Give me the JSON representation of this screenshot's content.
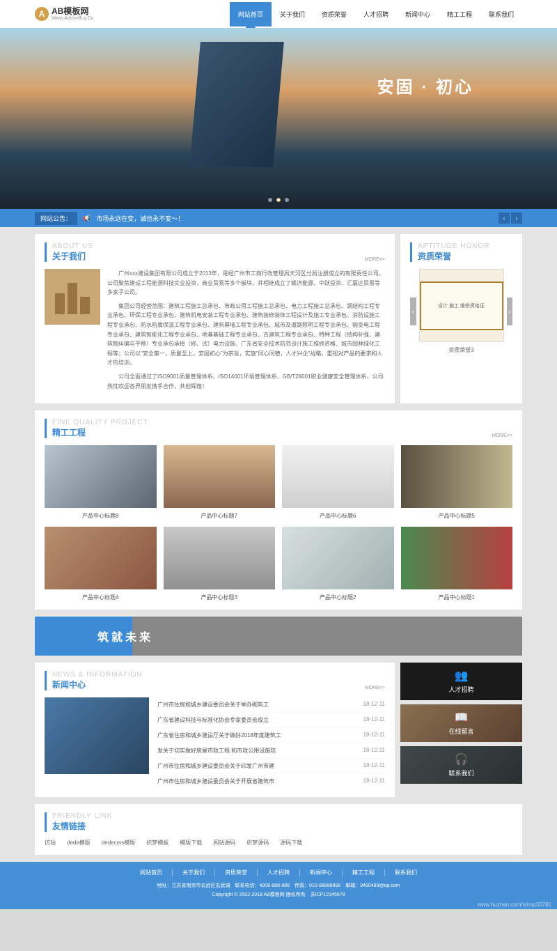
{
  "logo": {
    "initial": "A",
    "title": "AB模板网",
    "sub": "Www.AdminBuy.Cn"
  },
  "nav": [
    "网站首页",
    "关于我们",
    "资质荣誉",
    "人才招聘",
    "新闻中心",
    "精工工程",
    "联系我们"
  ],
  "hero": {
    "tagline": "安固 · 初心"
  },
  "notice": {
    "label": "网站公告：",
    "text": "市场永远在变，诚信永不变～！"
  },
  "about": {
    "en": "ABOUT US",
    "cn": "关于我们",
    "more": "MORE>>",
    "p1": "广州xxx建设集团有限公司成立于2013年，是经广州市工商行政管理局天河区分局注册成立的有限责任公司。公司聚焦建设工程能源科技实业投资，商业贸易等多个板块，并相继成立了赣济能源、中跃投资、汇赢达贸易等多家子公司。",
    "p2": "集团公司经营范围：建筑工程施工总承包、市政公用工程施工总承包、电力工程施工总承包、钢结构工程专业承包、环保工程专业承包、建筑机电安装工程专业承包、建筑装修装饰工程设计及施工专业承包、消防设施工程专业承包、防水防腐保温工程专业承包、建筑幕墙工程专业承包、城市及道路照明工程专业承包、输变电工程专业承包、建筑智能化工程专业承包、地基基础工程专业承包、古建筑工程专业承包、特种工程（结构补强、建筑物纠偏与平移）专业承包承接（修、试）电力设施、广东省安全技术防范设计施工维修资格、城市园林绿化工程等；公司以\"安全第一，质量至上，安固初心\"为宗旨，实施\"同心同德，人才兴企\"战略，重视对产品的要求和人才的培训。",
    "p3": "公司全面通过了ISO9001质量管理体系、ISO14001环境管理体系、GB/T28001职业健康安全管理体系，公司热忱欢迎各界朋友携手合作，共创辉煌！"
  },
  "honor": {
    "en": "APTITUDE HONOR",
    "cn": "资质荣誉",
    "cert": "设计 施工 维修资格证",
    "cap": "资质荣誉3"
  },
  "projects": {
    "en": "FINE QUALITY PROJECT",
    "cn": "精工工程",
    "more": "MORE>>",
    "items": [
      "产品中心标题8",
      "产品中心标题7",
      "产品中心标题6",
      "产品中心标题5",
      "产品中心标题4",
      "产品中心标题3",
      "产品中心标题2",
      "产品中心标题1"
    ]
  },
  "strip": "筑就未来",
  "news": {
    "en": "NEWS & INFORMATION",
    "cn": "新闻中心",
    "more": "MORE>>",
    "items": [
      {
        "t": "广州市住房和城乡建设委员会关于举办砌筑工",
        "d": "18-12-11"
      },
      {
        "t": "广东省建设科技与标准化协会专家委员会成立",
        "d": "18-12-11"
      },
      {
        "t": "广东省住房和城乡建设厅关于做好2018年度建筑工",
        "d": "18-12-11"
      },
      {
        "t": "发关于切实做好房屋市政工程 和市政公用设施防",
        "d": "18-12-11"
      },
      {
        "t": "广州市住房和城乡建设委员会关于印发广州市建",
        "d": "18-12-11"
      },
      {
        "t": "广州市住房和城乡建设委员会关于开展省建筑市",
        "d": "18-12-11"
      }
    ]
  },
  "sidebar": [
    {
      "icon": "👥",
      "label": "人才招聘"
    },
    {
      "icon": "📖",
      "label": "在线留言"
    },
    {
      "icon": "🎧",
      "label": "联系我们"
    }
  ],
  "links": {
    "en": "FRIENDLY LINK",
    "cn": "友情链接",
    "items": [
      "仿站",
      "dede模版",
      "dedecms模版",
      "织梦模板",
      "模版下载",
      "网站源码",
      "织梦源码",
      "源码下载"
    ]
  },
  "footer": {
    "nav": [
      "网站首页",
      "关于我们",
      "资质荣誉",
      "人才招聘",
      "新闻中心",
      "精工工程",
      "联系我们"
    ],
    "addr": "地址：江苏省南京市玄武区玄武湖　联系电话：4008-888-888　传真：010-88888888　邮箱：9490489@qq.com",
    "copy": "Copyright © 2002-2018 AB模板网 版权所有　苏ICP12345678"
  },
  "watermark": "www.huzhan.com/ishop33781"
}
